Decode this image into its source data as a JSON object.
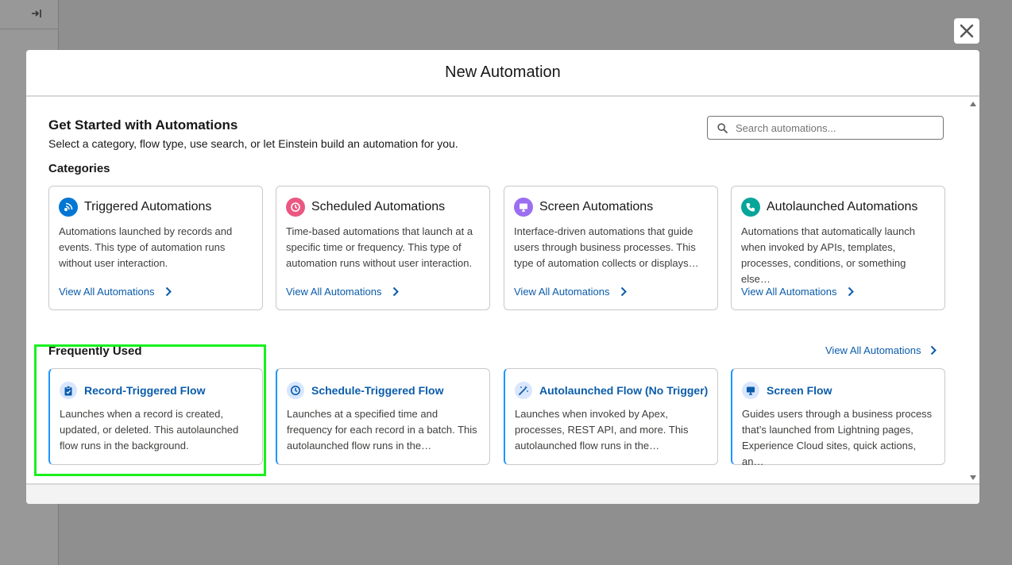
{
  "modal": {
    "title": "New Automation",
    "intro_title": "Get Started with Automations",
    "intro_subtitle": "Select a category, flow type, use search, or let Einstein build an automation for you.",
    "search_placeholder": "Search automations..."
  },
  "categories": {
    "heading": "Categories",
    "items": [
      {
        "title": "Triggered Automations",
        "desc": "Automations launched by records and events. This type of automation runs without user interaction.",
        "link": "View All Automations",
        "icon": "triggered-icon",
        "color": "#0176d3"
      },
      {
        "title": "Scheduled Automations",
        "desc": "Time-based automations that launch at a specific time or frequency. This type of automation runs without user interaction.",
        "link": "View All Automations",
        "icon": "clock-icon",
        "color": "#ea5882"
      },
      {
        "title": "Screen Automations",
        "desc": "Interface-driven automations that guide users through business processes. This type of automation collects or displays…",
        "link": "View All Automations",
        "icon": "monitor-icon",
        "color": "#9b6ff0"
      },
      {
        "title": "Autolaunched Automations",
        "desc": "Automations that automatically launch when invoked by APIs, templates, processes, conditions, or something else…",
        "link": "View All Automations",
        "icon": "phone-icon",
        "color": "#06a59a"
      }
    ]
  },
  "frequent": {
    "heading": "Frequently Used",
    "view_all": "View All Automations",
    "items": [
      {
        "title": "Record-Triggered Flow",
        "desc": "Launches when a record is created, updated, or deleted. This autolaunched flow runs in the background.",
        "icon": "clipboard-icon"
      },
      {
        "title": "Schedule-Triggered Flow",
        "desc": "Launches at a specified time and frequency for each record in a batch. This autolaunched flow runs in the…",
        "icon": "clock-icon"
      },
      {
        "title": "Autolaunched Flow (No Trigger)",
        "desc": "Launches when invoked by Apex, processes, REST API, and more. This autolaunched flow runs in the…",
        "icon": "magic-wand-icon"
      },
      {
        "title": "Screen Flow",
        "desc": "Guides users through a business process that’s launched from Lightning pages, Experience Cloud sites, quick actions, an…",
        "icon": "monitor-icon"
      }
    ]
  },
  "colors": {
    "accent": "#0b5cab",
    "highlight": "#19f01e",
    "card_border_accent": "#1b96ff"
  }
}
